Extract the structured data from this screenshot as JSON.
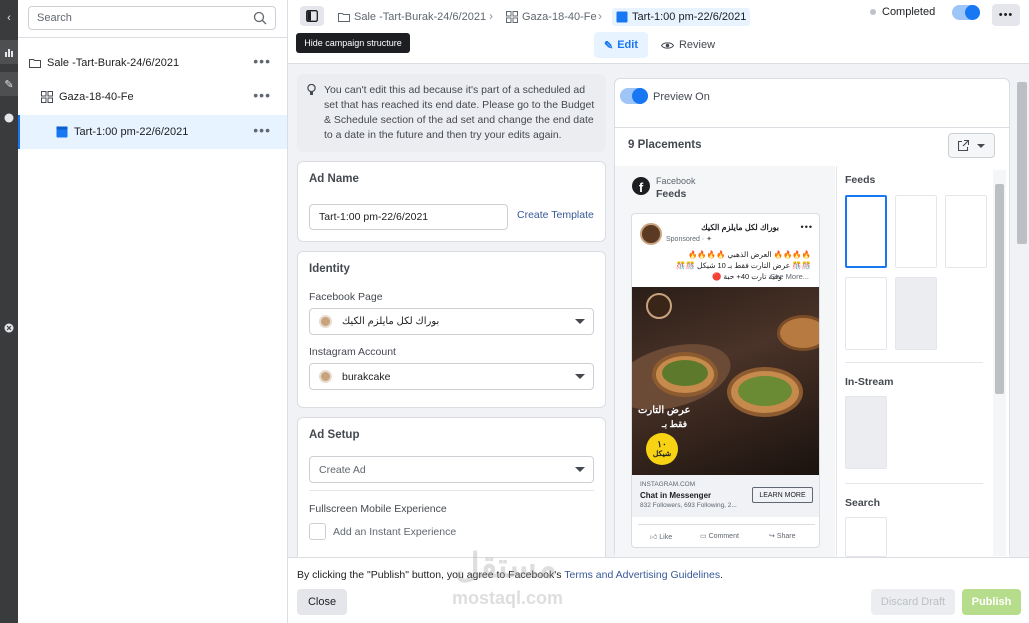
{
  "sidebar": {
    "search_placeholder": "Search",
    "campaign": "Sale -Tart-Burak-24/6/2021",
    "adset": "Gaza-18-40-Fe",
    "ad": "Tart-1:00 pm-22/6/2021"
  },
  "breadcrumb": {
    "campaign": "Sale -Tart-Burak-24/6/2021",
    "adset": "Gaza-18-40-Fe",
    "ad": "Tart-1:00 pm-22/6/2021"
  },
  "tooltip": "Hide campaign structure",
  "status": "Completed",
  "tabs": {
    "edit": "Edit",
    "review": "Review"
  },
  "notice": "You can't edit this ad because it's part of a scheduled ad set that has reached its end date. Please go to the Budget & Schedule section of the ad set and change the end date to a date in the future and then try your edits again.",
  "ad_name": {
    "title": "Ad Name",
    "value": "Tart-1:00 pm-22/6/2021",
    "create_template": "Create Template"
  },
  "identity": {
    "title": "Identity",
    "facebook_page_label": "Facebook Page",
    "facebook_page": "بوراك لكل مايلزم الكيك",
    "instagram_label": "Instagram Account",
    "instagram_account": "burakcake"
  },
  "ad_setup": {
    "title": "Ad Setup",
    "create_ad": "Create Ad",
    "fullscreen_label": "Fullscreen Mobile Experience",
    "instant_experience": "Add an Instant Experience"
  },
  "preview": {
    "toggle_label": "Preview On",
    "placements": "9 Placements",
    "platform": "Facebook",
    "placement_name": "Feeds",
    "post": {
      "page_name": "بوراك لكل مايلزم الكيك",
      "sponsored": "Sponsored · ✦",
      "line1": "🔥🔥🔥🔥 العرض الذهبي 🔥🔥🔥🔥",
      "line2": "🎊🎊 عرض التارت فقط بـ 10 شيكل 🎊🎊",
      "line3": "وقية تارت 40+ حبة 🔴",
      "see_more": "See More...",
      "image_text1": "عرض التارت",
      "image_text2": "فقط بـ",
      "badge_number": "١٠",
      "badge_unit": "شيكل",
      "domain": "INSTAGRAM.COM",
      "cta_title": "Chat in Messenger",
      "cta_sub": "832 Followers, 693 Following, 2...",
      "learn_more": "LEARN MORE",
      "like": "Like",
      "comment": "Comment",
      "share": "Share"
    },
    "groups": {
      "feeds": "Feeds",
      "instream": "In-Stream",
      "search": "Search"
    }
  },
  "footer": {
    "terms_prefix": "By clicking the \"Publish\" button, you agree to Facebook's",
    "terms_link": "Terms and Advertising Guidelines",
    "terms_suffix": ".",
    "close": "Close",
    "discard": "Discard Draft",
    "publish": "Publish"
  },
  "watermark": {
    "arabic": "مستقل",
    "latin": "mostaql.com"
  },
  "colors": {
    "accent": "#1877f2",
    "publish_disabled": "#b5dd8b",
    "folder": "#1877f2"
  }
}
